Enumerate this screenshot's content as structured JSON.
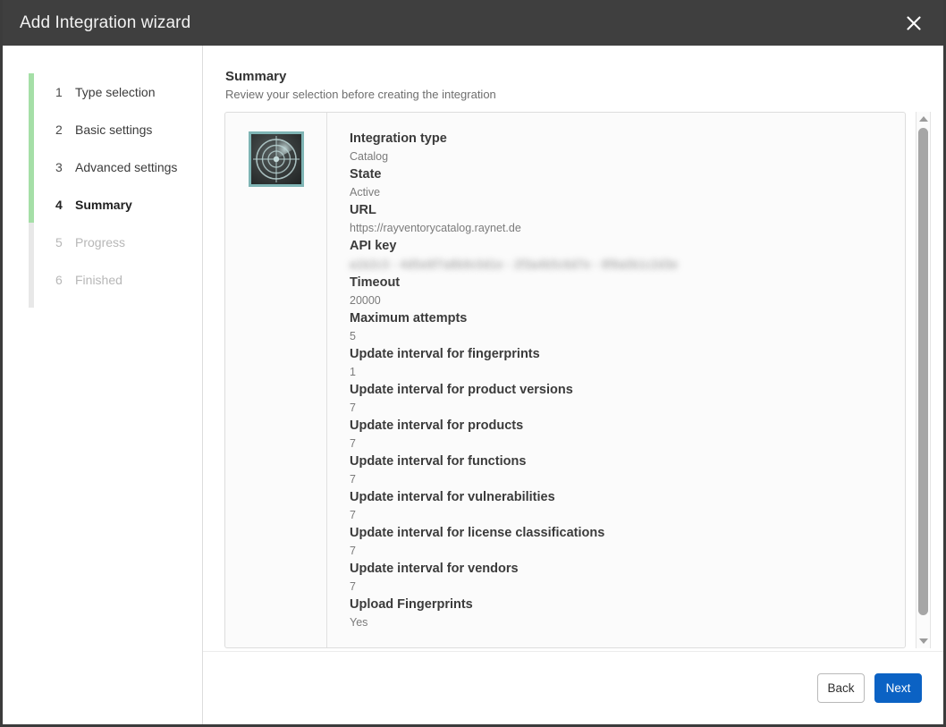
{
  "window": {
    "title": "Add Integration wizard",
    "close_icon": "close-icon"
  },
  "sidebar": {
    "steps": [
      {
        "num": "1",
        "label": "Type selection",
        "state": "done"
      },
      {
        "num": "2",
        "label": "Basic settings",
        "state": "done"
      },
      {
        "num": "3",
        "label": "Advanced settings",
        "state": "done"
      },
      {
        "num": "4",
        "label": "Summary",
        "state": "active"
      },
      {
        "num": "5",
        "label": "Progress",
        "state": "disabled"
      },
      {
        "num": "6",
        "label": "Finished",
        "state": "disabled"
      }
    ],
    "rail_done_color": "#a5dfa7",
    "rail_color": "#e8e8e8"
  },
  "header": {
    "title": "Summary",
    "subtitle": "Review your selection before creating the integration"
  },
  "summary": {
    "icon": "radar-icon",
    "icon_border_color": "#7fb5b5",
    "fields": [
      {
        "label": "Integration type",
        "value": "Catalog",
        "blurred": false
      },
      {
        "label": "State",
        "value": "Active",
        "blurred": false
      },
      {
        "label": "URL",
        "value": "https://rayventorycatalog.raynet.de",
        "blurred": false
      },
      {
        "label": "API key",
        "value": "a1b2c3 - 4d5e6f7a8b9c0d1e - 2f3a4b5c6d7e - 8f9a0b1c2d3e",
        "blurred": true
      },
      {
        "label": "Timeout",
        "value": "20000",
        "blurred": false
      },
      {
        "label": "Maximum attempts",
        "value": "5",
        "blurred": false
      },
      {
        "label": "Update interval for fingerprints",
        "value": "1",
        "blurred": false
      },
      {
        "label": "Update interval for product versions",
        "value": "7",
        "blurred": false
      },
      {
        "label": "Update interval for products",
        "value": "7",
        "blurred": false
      },
      {
        "label": "Update interval for functions",
        "value": "7",
        "blurred": false
      },
      {
        "label": "Update interval for vulnerabilities",
        "value": "7",
        "blurred": false
      },
      {
        "label": "Update interval for license classifications",
        "value": "7",
        "blurred": false
      },
      {
        "label": "Update interval for vendors",
        "value": "7",
        "blurred": false
      },
      {
        "label": "Upload Fingerprints",
        "value": "Yes",
        "blurred": false
      }
    ]
  },
  "scrollbar": {
    "up_icon": "chevron-up-icon",
    "down_icon": "chevron-down-icon"
  },
  "footer": {
    "back_label": "Back",
    "next_label": "Next",
    "next_color": "#0b62c4"
  }
}
